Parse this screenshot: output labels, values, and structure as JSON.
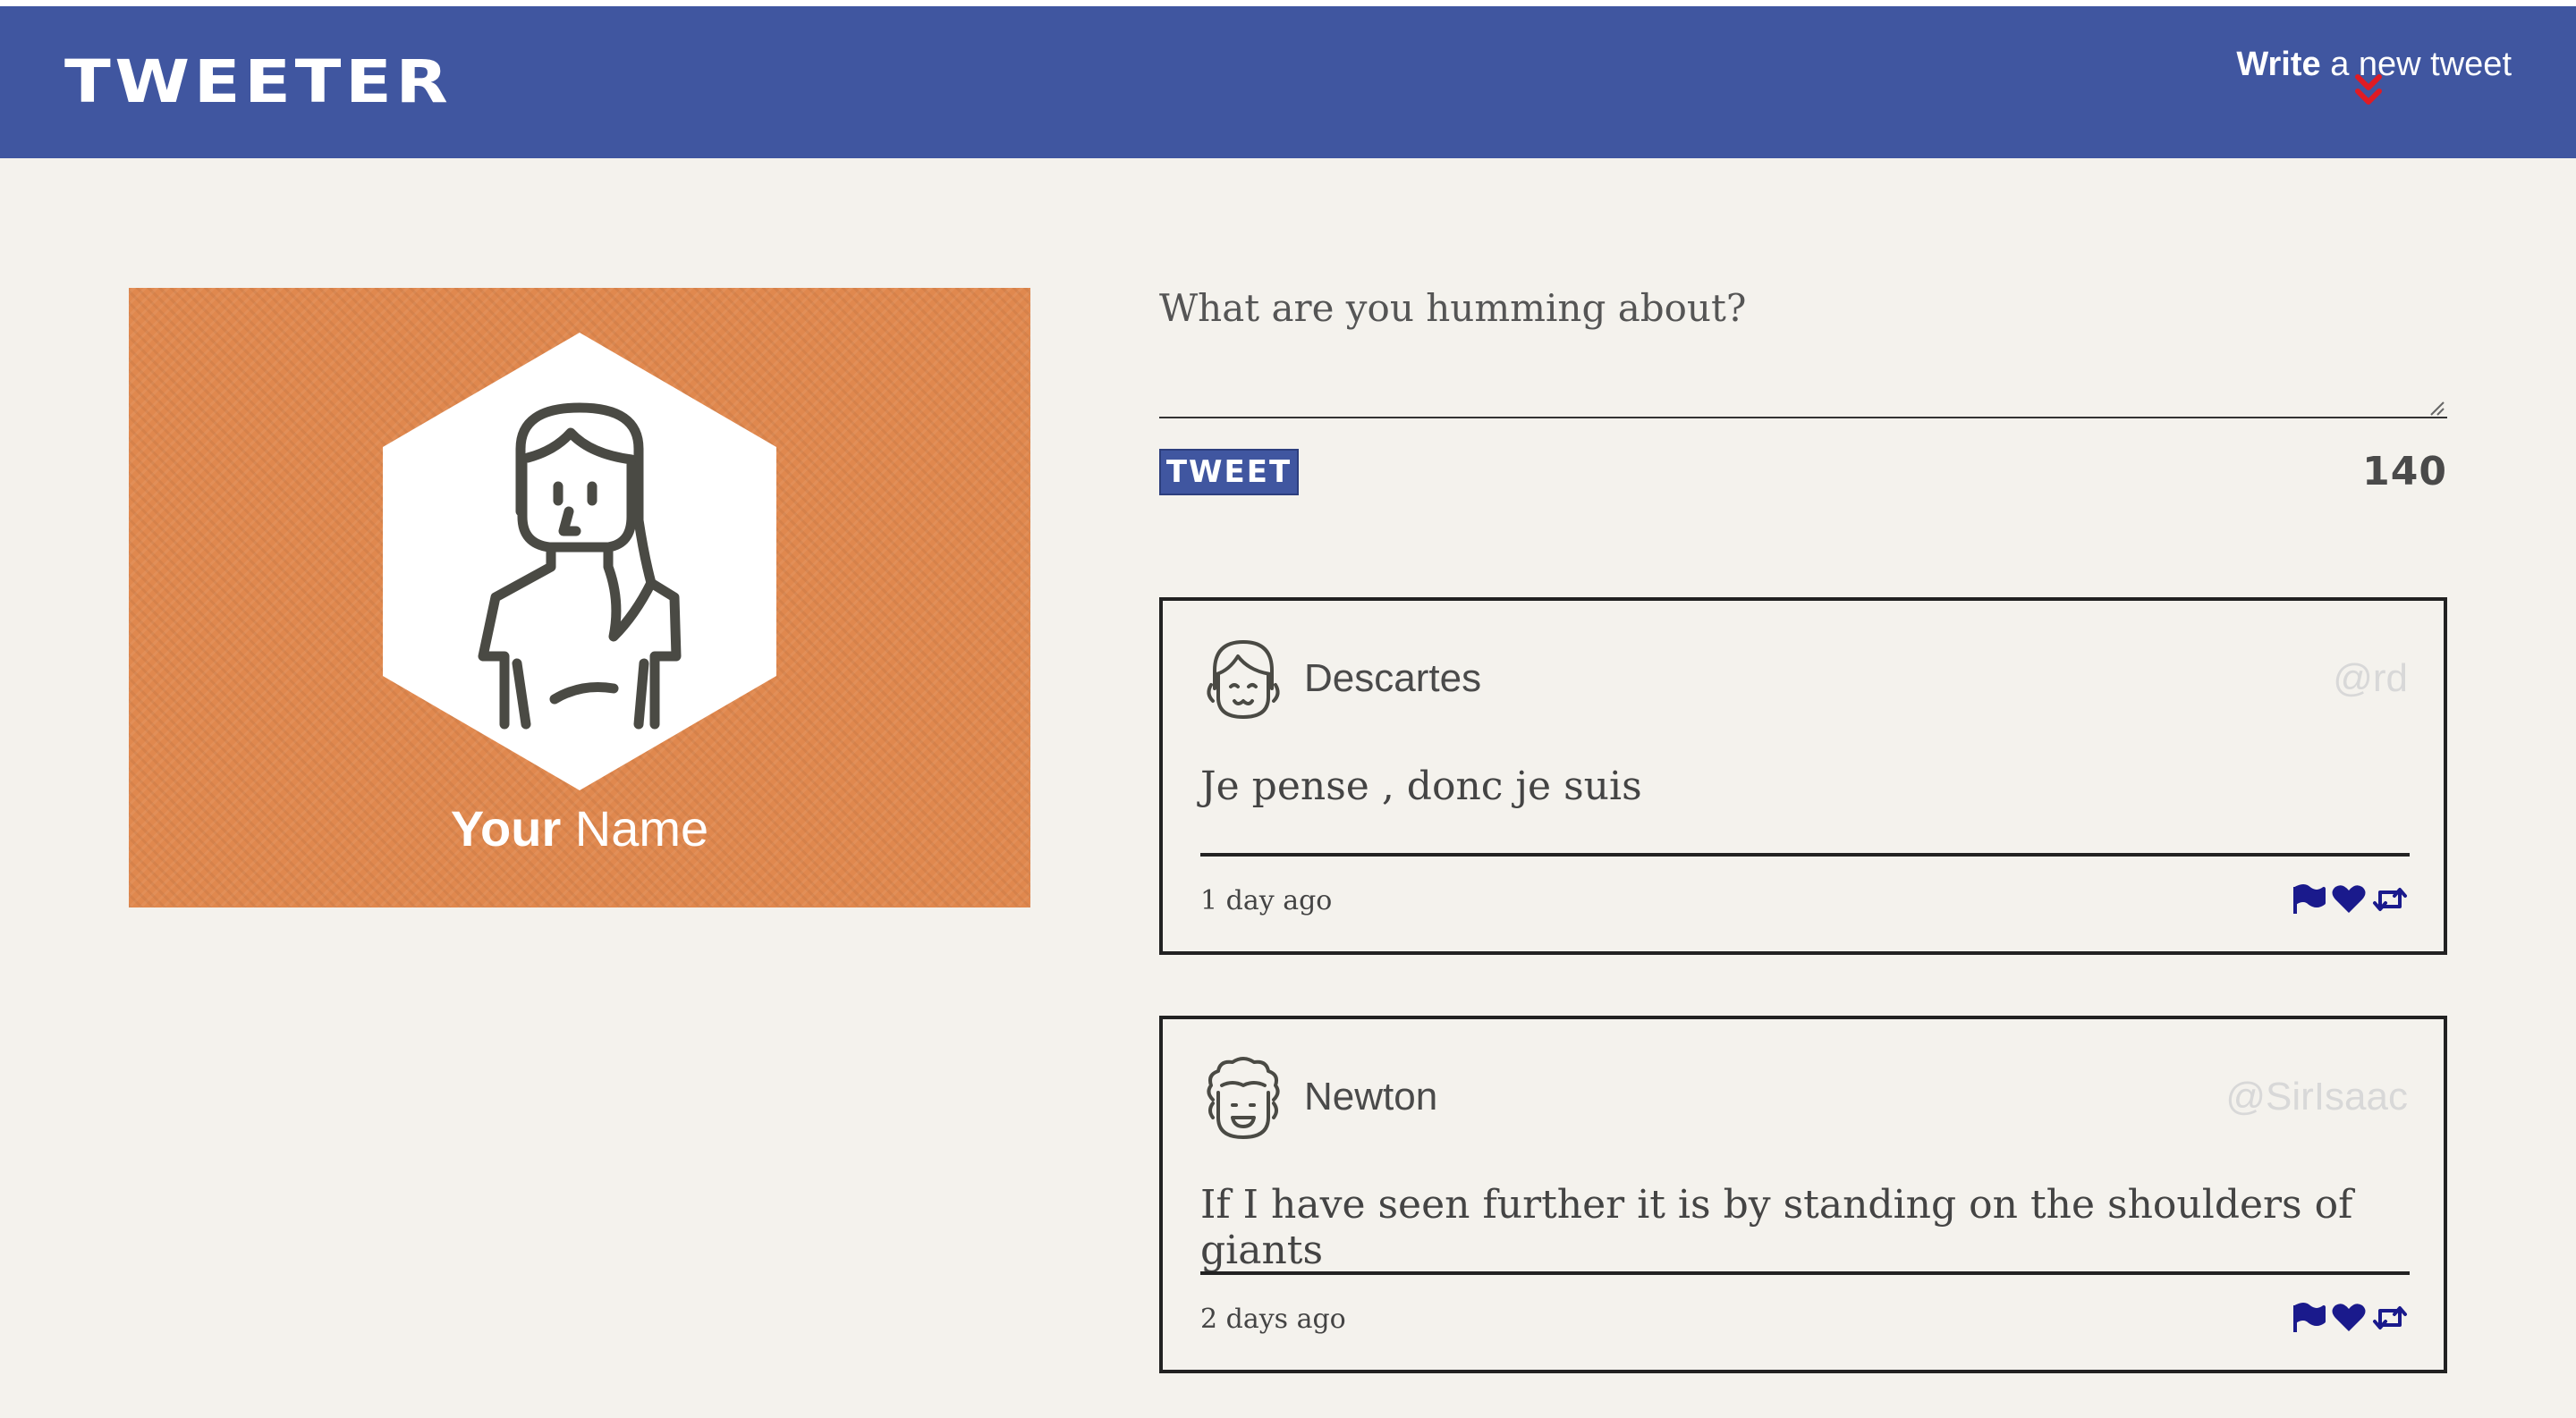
{
  "nav": {
    "brand": "TWEETER",
    "compose_write": "Write",
    "compose_rest": " a new tweet"
  },
  "profile": {
    "first_name": "Your",
    "last_name": " Name",
    "background_color": "#e0884e"
  },
  "compose": {
    "placeholder": "What are you humming about?",
    "button_label": "TWEET",
    "counter": "140"
  },
  "tweets": [
    {
      "name": "Descartes",
      "handle": "@rd",
      "content": "Je pense , donc je suis",
      "age": "1 day ago",
      "avatar_icon": "girl-face-icon"
    },
    {
      "name": "Newton",
      "handle": "@SirIsaac",
      "content": "If I have seen further it is by standing on the shoulders of giants",
      "age": "2 days ago",
      "avatar_icon": "curly-hair-face-icon"
    }
  ],
  "colors": {
    "navbar": "#4056a0",
    "page_background": "#f4f2ed",
    "action_icons": "#1a1a8c",
    "chevron": "#e01b24"
  },
  "icons": {
    "chevron": "double-chevron-down-icon",
    "flag": "flag-icon",
    "heart": "heart-icon",
    "retweet": "retweet-icon"
  }
}
